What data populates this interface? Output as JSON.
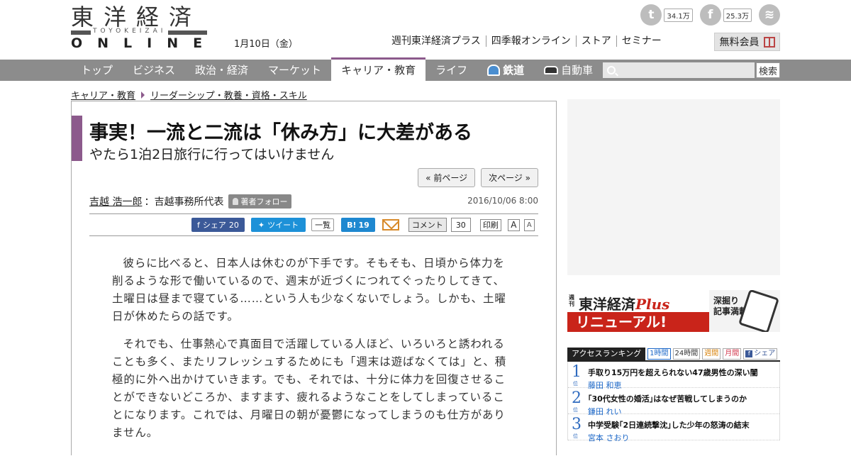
{
  "header": {
    "logo_jp": "東洋経済",
    "logo_roman": "TOYOKEIZAI",
    "logo_online": "ONLINE",
    "date": "1月10日（金）",
    "social": [
      {
        "name": "twitter",
        "glyph": "t",
        "count": "34.1万"
      },
      {
        "name": "facebook",
        "glyph": "f",
        "count": "25.3万"
      },
      {
        "name": "rss",
        "glyph": "≋",
        "count": ""
      }
    ],
    "links": [
      "週刊東洋経済プラス",
      "四季報オンライン",
      "ストア",
      "セミナー"
    ],
    "member_label": "無料会員"
  },
  "nav": {
    "items": [
      "トップ",
      "ビジネス",
      "政治・経済",
      "マーケット",
      "キャリア・教育",
      "ライフ",
      "鉄道",
      "自動車"
    ],
    "active_index": 4,
    "search_placeholder": "",
    "search_button": "検索"
  },
  "breadcrumb": [
    "キャリア・教育",
    "リーダーシップ・教養・資格・スキル"
  ],
  "article": {
    "title": "事実！一流と二流は「休み方」に大差がある",
    "subtitle": "やたら1泊2日旅行に行ってはいけません",
    "prev_label": "« 前ページ",
    "next_label": "次ページ »",
    "author_name": "吉越 浩一郎",
    "author_role": "：吉越事務所代表",
    "follow_label": "著者フォロー",
    "pubdate": "2016/10/06 8:00",
    "share": {
      "fb_label": "シェア",
      "fb_count": "20",
      "tw_label": "ツイート",
      "list_label": "一覧",
      "hb_label": "B!",
      "hb_count": "19",
      "comment_label": "コメント",
      "comment_count": "30",
      "print_label": "印刷",
      "font_large": "A",
      "font_small": "A"
    },
    "paragraphs": [
      "彼らに比べると、日本人は休むのが下手です。そもそも、日頃から体力を削るような形で働いているので、週末が近づくにつれてぐったりしてきて、土曜日は昼まで寝ている……という人も少なくないでしょう。しかも、土曜日が休めたらの話です。",
      "それでも、仕事熱心で真面目で活躍している人ほど、いろいろと誘われることも多く、またリフレッシュするためにも「週末は遊ばなくては」と、積極的に外へ出かけていきます。でも、それでは、十分に体力を回復させることができないどころか、ますます、疲れるようなことをしてしまっていることになります。これでは、月曜日の朝が憂鬱になってしまうのも仕方がありません。"
    ]
  },
  "banner": {
    "small": "週刊",
    "magazine": "東洋経済",
    "plus": "Plus",
    "renewal": "リニューアル!",
    "tag_line1": "深掘り",
    "tag_line2": "記事満載"
  },
  "ranking": {
    "title": "アクセスランキング",
    "tabs": [
      "1時間",
      "24時間",
      "週間",
      "月間",
      "シェア"
    ],
    "unit": "位",
    "items": [
      {
        "rank": "1",
        "title": "手取り15万円を超えられない47歳男性の深い闇",
        "author": "藤田 和恵"
      },
      {
        "rank": "2",
        "title": "｢30代女性の婚活｣はなぜ苦戦してしまうのか",
        "author": "鎌田 れい"
      },
      {
        "rank": "3",
        "title": "中学受験｢2日連続撃沈｣した少年の怒涛の結末",
        "author": "宮本 さおり"
      }
    ]
  }
}
